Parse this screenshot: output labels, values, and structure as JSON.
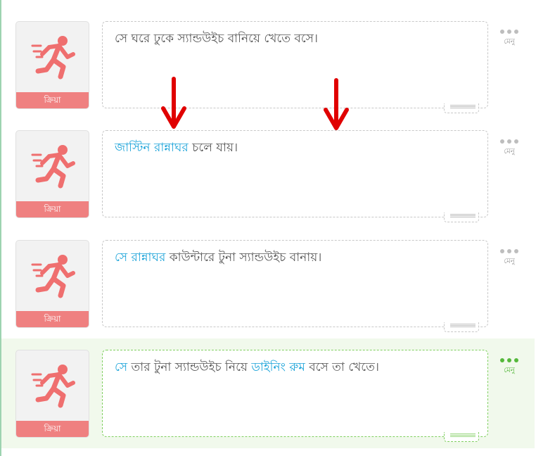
{
  "colors": {
    "label_bar": "#ef8080",
    "runner_icon": "#ef6f6f",
    "highlight_text": "#1aa3d9",
    "selected_accent": "#55b83b",
    "selected_row_bg": "#f1f9ec",
    "arrow": "#e00000"
  },
  "rows": [
    {
      "action_label": "ক্রিয়া",
      "icon": "running-person-icon",
      "selected": false,
      "segments": [
        {
          "text": "সে ঘরে ঢুকে স্যান্ডউইচ বানিয়ে খেতে বসে।",
          "highlight": false
        }
      ],
      "menu_label": "মেনু"
    },
    {
      "action_label": "ক্রিয়া",
      "icon": "running-person-icon",
      "selected": false,
      "segments": [
        {
          "text": "জাস্টিন",
          "highlight": true
        },
        {
          "text": " ",
          "highlight": false
        },
        {
          "text": "রান্নাঘর",
          "highlight": true
        },
        {
          "text": " চলে যায়।",
          "highlight": false
        }
      ],
      "menu_label": "মেনু"
    },
    {
      "action_label": "ক্রিয়া",
      "icon": "running-person-icon",
      "selected": false,
      "segments": [
        {
          "text": "সে",
          "highlight": true
        },
        {
          "text": " ",
          "highlight": false
        },
        {
          "text": "রান্নাঘর",
          "highlight": true
        },
        {
          "text": " কাউন্টারে টুনা স্যান্ডউইচ বানায়।",
          "highlight": false
        }
      ],
      "menu_label": "মেনু"
    },
    {
      "action_label": "ক্রিয়া",
      "icon": "running-person-icon",
      "selected": true,
      "segments": [
        {
          "text": "সে",
          "highlight": true
        },
        {
          "text": " তার টুনা স্যান্ডউইচ নিয়ে ",
          "highlight": false
        },
        {
          "text": "ডাইনিং রুম",
          "highlight": true
        },
        {
          "text": " বসে তা খেতে।",
          "highlight": false
        }
      ],
      "menu_label": "মেনু"
    }
  ],
  "annotations": {
    "arrows": [
      "down-arrow",
      "down-arrow"
    ]
  }
}
